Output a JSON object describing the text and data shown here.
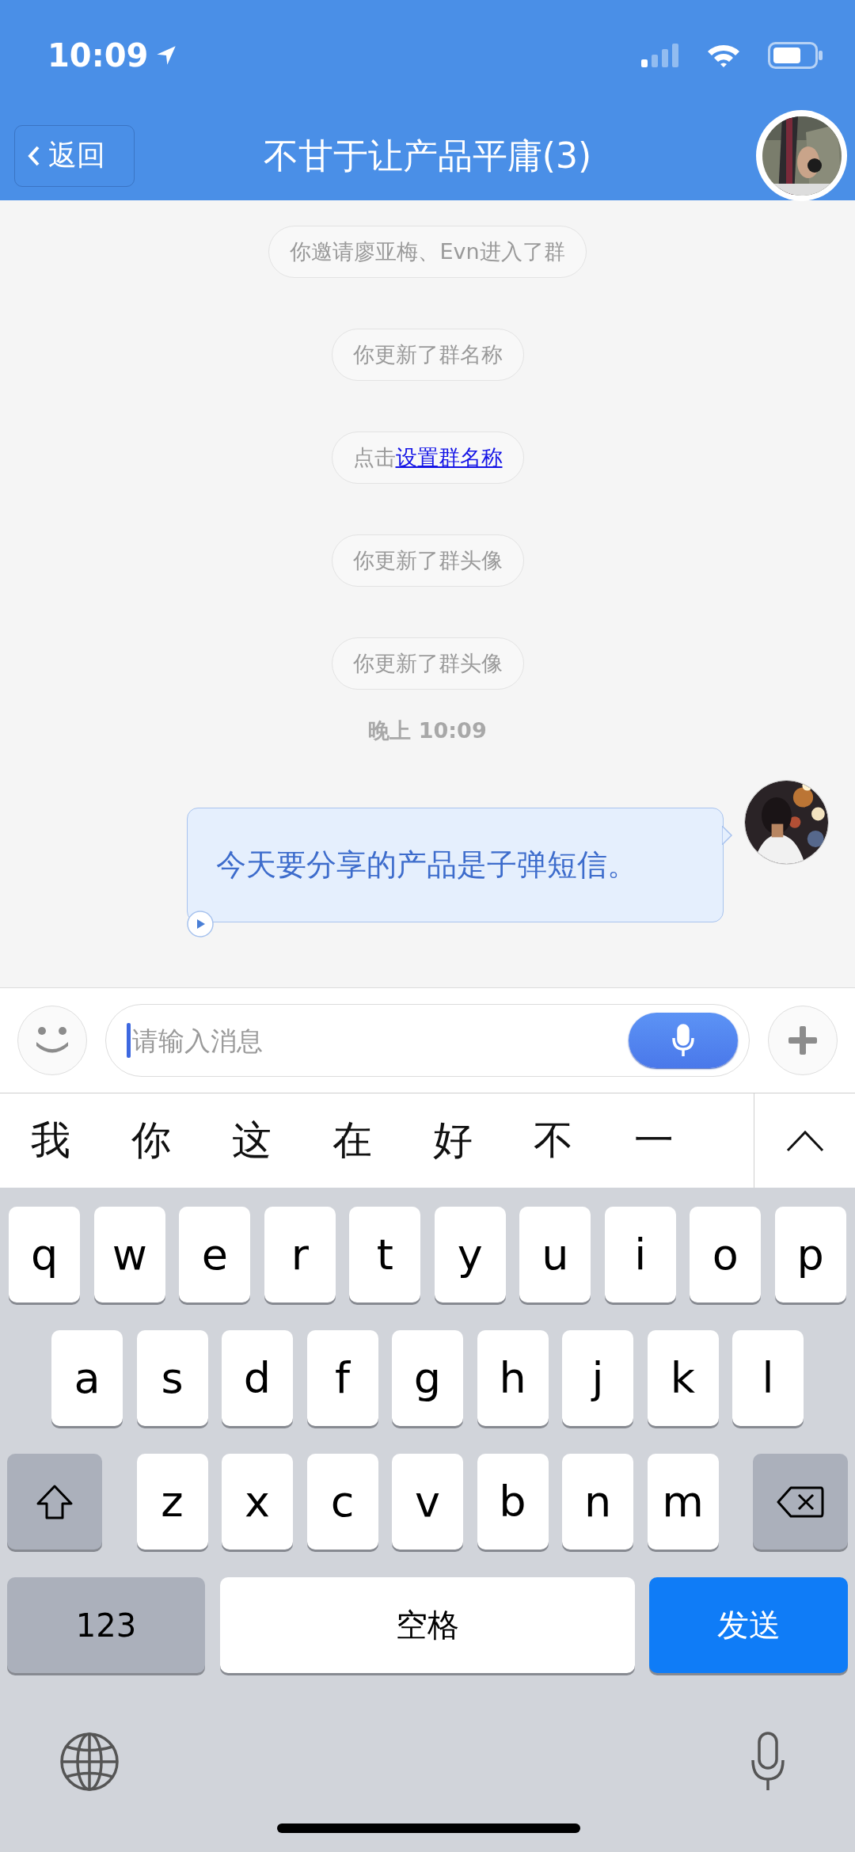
{
  "status_bar": {
    "time": "10:09"
  },
  "header": {
    "back_label": "返回",
    "title": "不甘于让产品平庸(3)"
  },
  "messages": [
    {
      "kind": "notice",
      "text": "你邀请廖亚梅、Evn进入了群"
    },
    {
      "kind": "notice",
      "text": "你更新了群名称"
    },
    {
      "kind": "link_notice",
      "text": "点击",
      "link": "设置群名称"
    },
    {
      "kind": "notice",
      "text": "你更新了群头像"
    },
    {
      "kind": "notice",
      "text": "你更新了群头像"
    },
    {
      "kind": "timestamp",
      "text": "晚上 10:09"
    },
    {
      "kind": "bubble",
      "text": "今天要分享的产品是子弹短信。"
    }
  ],
  "input": {
    "placeholder": "请输入消息"
  },
  "candidates": [
    "我",
    "你",
    "这",
    "在",
    "好",
    "不",
    "一"
  ],
  "keyboard": {
    "rows": [
      {
        "keys": [
          {
            "kind": "letter",
            "label": "q"
          },
          {
            "kind": "letter",
            "label": "w"
          },
          {
            "kind": "letter",
            "label": "e"
          },
          {
            "kind": "letter",
            "label": "r"
          },
          {
            "kind": "letter",
            "label": "t"
          },
          {
            "kind": "letter",
            "label": "y"
          },
          {
            "kind": "letter",
            "label": "u"
          },
          {
            "kind": "letter",
            "label": "i"
          },
          {
            "kind": "letter",
            "label": "o"
          },
          {
            "kind": "letter",
            "label": "p"
          }
        ]
      },
      {
        "keys": [
          {
            "kind": "letter",
            "label": "a"
          },
          {
            "kind": "letter",
            "label": "s"
          },
          {
            "kind": "letter",
            "label": "d"
          },
          {
            "kind": "letter",
            "label": "f"
          },
          {
            "kind": "letter",
            "label": "g"
          },
          {
            "kind": "letter",
            "label": "h"
          },
          {
            "kind": "letter",
            "label": "j"
          },
          {
            "kind": "letter",
            "label": "k"
          },
          {
            "kind": "letter",
            "label": "l"
          }
        ]
      },
      {
        "keys": [
          {
            "kind": "shift"
          },
          {
            "kind": "letter",
            "label": "z"
          },
          {
            "kind": "letter",
            "label": "x"
          },
          {
            "kind": "letter",
            "label": "c"
          },
          {
            "kind": "letter",
            "label": "v"
          },
          {
            "kind": "letter",
            "label": "b"
          },
          {
            "kind": "letter",
            "label": "n"
          },
          {
            "kind": "letter",
            "label": "m"
          },
          {
            "kind": "delete"
          }
        ]
      },
      {
        "keys": [
          {
            "kind": "mode",
            "label": "123"
          },
          {
            "kind": "space",
            "label": "空格"
          },
          {
            "kind": "send",
            "label": "发送"
          }
        ]
      }
    ]
  }
}
